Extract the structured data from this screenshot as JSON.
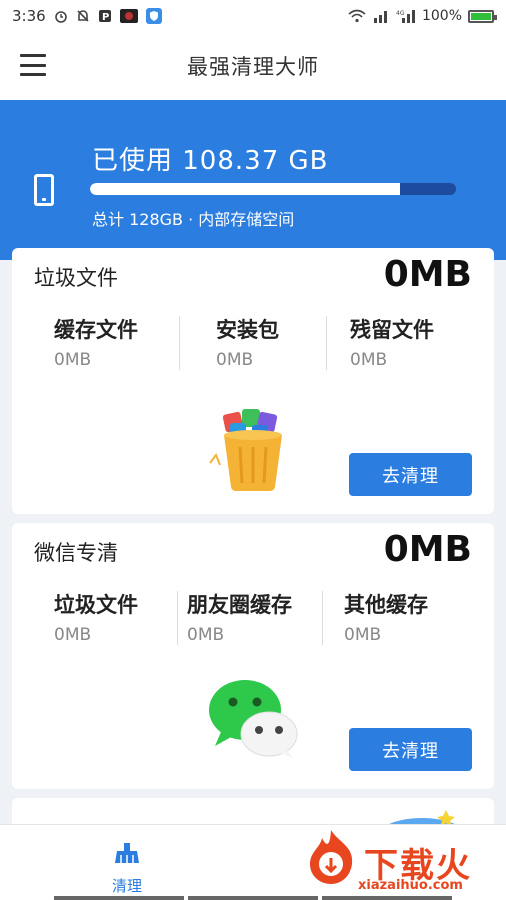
{
  "status_bar": {
    "time": "3:36",
    "battery": "100%",
    "icons_left": [
      "alarm-icon",
      "notification-off-icon",
      "p-app-icon",
      "camera-app-icon",
      "shield-app-icon"
    ],
    "icons_right": [
      "wifi-icon",
      "signal-icon",
      "4g-signal-icon",
      "battery-icon"
    ]
  },
  "app_bar": {
    "title": "最强清理大师",
    "menu_icon": "hamburger-menu-icon"
  },
  "storage": {
    "used_text": "已使用 108.37 GB",
    "total_text": "总计 128GB · 内部存储空间",
    "used_fraction": 0.847,
    "icon": "phone-icon"
  },
  "junk_card": {
    "title": "垃圾文件",
    "total": "0MB",
    "stats": [
      {
        "label": "缓存文件",
        "value": "0MB"
      },
      {
        "label": "安装包",
        "value": "0MB"
      },
      {
        "label": "残留文件",
        "value": "0MB"
      }
    ],
    "button": "去清理",
    "illustration": "trash-can-icon"
  },
  "wechat_card": {
    "title": "微信专清",
    "total": "0MB",
    "stats": [
      {
        "label": "垃圾文件",
        "value": "0MB"
      },
      {
        "label": "朋友圈缓存",
        "value": "0MB"
      },
      {
        "label": "其他缓存",
        "value": "0MB"
      }
    ],
    "button": "去清理",
    "illustration": "wechat-icon"
  },
  "bottom_nav": {
    "items": [
      {
        "label": "清理",
        "icon": "broom-icon"
      }
    ]
  },
  "watermark": {
    "text": "下载火",
    "sub": "xiazaihuo.com"
  },
  "colors": {
    "primary": "#2b7de0",
    "progress_track": "#1d4c9f",
    "watermark": "#e8461f"
  }
}
